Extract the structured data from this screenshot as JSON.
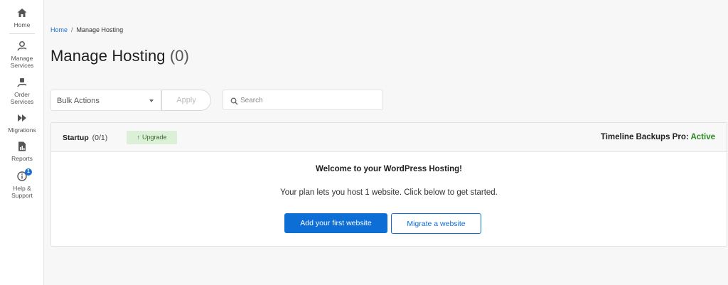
{
  "sidebar": {
    "items": [
      {
        "label": "Home",
        "icon": "home-icon"
      },
      {
        "label": "Manage\nServices",
        "icon": "manage-services-icon"
      },
      {
        "label": "Order\nServices",
        "icon": "order-services-icon"
      },
      {
        "label": "Migrations",
        "icon": "migrations-icon"
      },
      {
        "label": "Reports",
        "icon": "reports-icon"
      },
      {
        "label": "Help &\nSupport",
        "icon": "help-icon"
      }
    ],
    "help_badge": "1"
  },
  "breadcrumb": {
    "home": "Home",
    "separator": "/",
    "current": "Manage Hosting"
  },
  "page": {
    "title": "Manage Hosting",
    "count": "(0)"
  },
  "toolbar": {
    "bulk_actions": "Bulk Actions",
    "apply_label": "Apply",
    "search_placeholder": "Search"
  },
  "card": {
    "plan_name": "Startup",
    "plan_slots": "(0/1)",
    "separator": "|",
    "upgrade_label": "Upgrade",
    "backups_label": "Timeline Backups Pro:",
    "backups_status": "Active",
    "welcome": "Welcome to your WordPress Hosting!",
    "description": "Your plan lets you host 1 website. Click below to get started.",
    "primary_button": "Add your first website",
    "secondary_button": "Migrate a website"
  },
  "colors": {
    "accent": "#0d6fd6",
    "active": "#2a8a20",
    "upgrade_bg": "#dcefd7"
  }
}
